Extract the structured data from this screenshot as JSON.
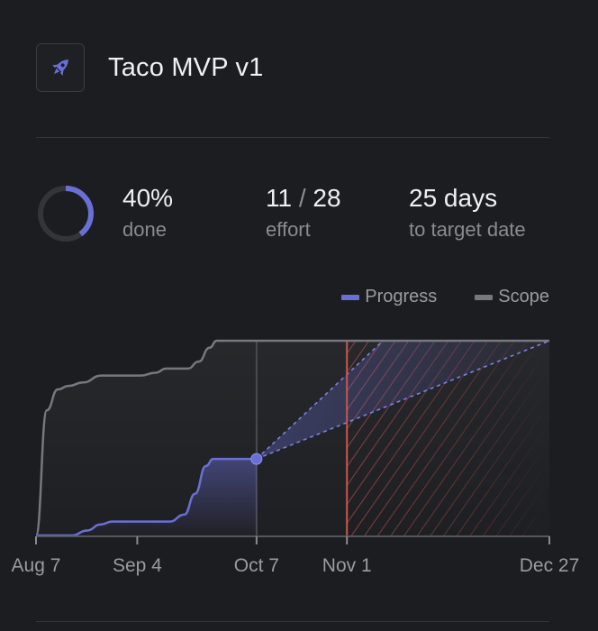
{
  "project": {
    "title": "Taco MVP v1",
    "icon": "rocket-icon",
    "accent": "#6a6fd6"
  },
  "stats": {
    "percent_done": 40,
    "percent_label": "40%",
    "percent_caption": "done",
    "effort_done": "11",
    "effort_sep": "/",
    "effort_total": "28",
    "effort_caption": "effort",
    "days_label": "25 days",
    "days_caption": "to target date"
  },
  "legend": {
    "progress_label": "Progress",
    "scope_label": "Scope",
    "progress_color": "#6a6fd6",
    "scope_color": "#77787e"
  },
  "chart_data": {
    "type": "line",
    "x_ticks": [
      {
        "label": "Aug 7",
        "day": 0
      },
      {
        "label": "Sep 4",
        "day": 28
      },
      {
        "label": "Oct 7",
        "day": 61
      },
      {
        "label": "Nov 1",
        "day": 86
      },
      {
        "label": "Dec 27",
        "day": 142
      }
    ],
    "today_marker": "Oct 7",
    "target_marker": "Nov 1",
    "ylim": [
      0,
      28
    ],
    "series": [
      {
        "name": "Scope",
        "color": "#77787e",
        "points": [
          [
            0,
            0
          ],
          [
            3,
            18
          ],
          [
            6,
            21
          ],
          [
            9,
            21.5
          ],
          [
            13,
            22
          ],
          [
            18,
            23
          ],
          [
            21,
            23
          ],
          [
            29,
            23
          ],
          [
            33,
            23.4
          ],
          [
            36,
            24
          ],
          [
            41,
            24
          ],
          [
            42,
            24
          ],
          [
            45,
            25
          ],
          [
            48,
            27
          ],
          [
            50,
            28
          ],
          [
            142,
            28
          ]
        ]
      },
      {
        "name": "Progress",
        "color": "#6a6fd6",
        "points": [
          [
            0,
            0
          ],
          [
            10,
            0
          ],
          [
            14,
            0.7
          ],
          [
            18,
            1.6
          ],
          [
            21,
            2
          ],
          [
            30,
            2
          ],
          [
            37,
            2
          ],
          [
            41,
            3
          ],
          [
            44,
            6
          ],
          [
            47,
            10
          ],
          [
            49,
            11
          ],
          [
            61,
            11
          ]
        ]
      }
    ],
    "projections": [
      {
        "from": [
          61,
          11
        ],
        "to": [
          142,
          28
        ]
      },
      {
        "from": [
          61,
          11
        ],
        "to": [
          96,
          28
        ]
      }
    ],
    "hatched_range": [
      86,
      142
    ]
  }
}
